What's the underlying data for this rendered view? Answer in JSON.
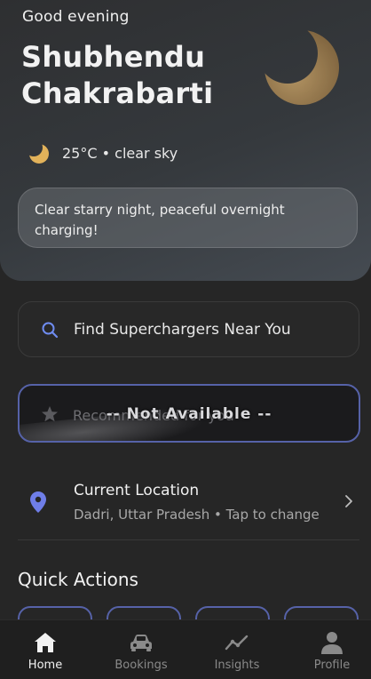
{
  "hero": {
    "greeting": "Good evening",
    "name_line1": "Shubhendu",
    "name_line2": "Chakrabarti",
    "weather_text": "25°C • clear sky",
    "weather_message": "Clear starry night, peaceful overnight charging!"
  },
  "search": {
    "label": "Find Superchargers Near You"
  },
  "recommend": {
    "label": "Recommended for you",
    "overlay": "-- Not Available --"
  },
  "location": {
    "title": "Current Location",
    "subtitle": "Dadri, Uttar Pradesh • Tap to change"
  },
  "quick_actions": {
    "title": "Quick Actions"
  },
  "bottom_nav": {
    "items": [
      {
        "label": "Home",
        "icon": "home-icon",
        "active": true
      },
      {
        "label": "Bookings",
        "icon": "car-icon",
        "active": false
      },
      {
        "label": "Insights",
        "icon": "chart-line-icon",
        "active": false
      },
      {
        "label": "Profile",
        "icon": "user-icon",
        "active": false
      }
    ]
  },
  "colors": {
    "accent": "#5662a8",
    "search_icon": "#6f8cf0",
    "pin": "#6f7ee8",
    "moon": "#c9a46a"
  }
}
